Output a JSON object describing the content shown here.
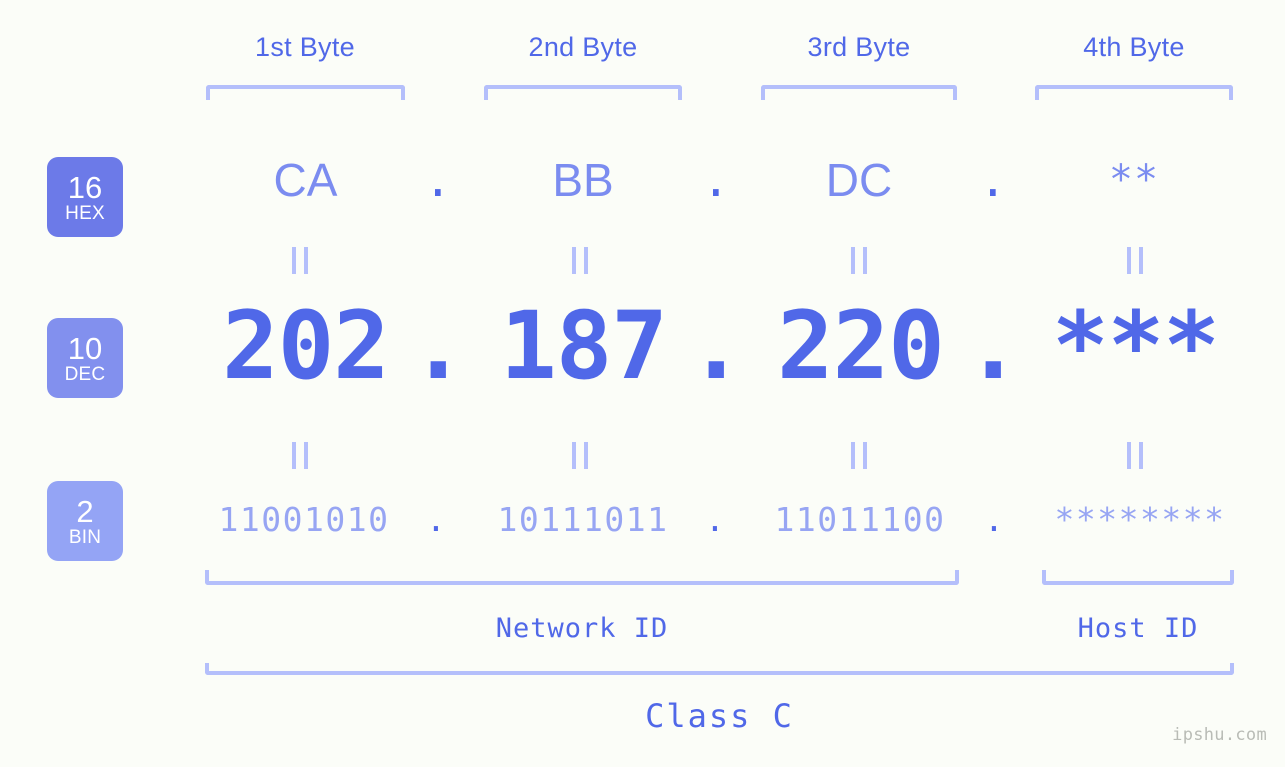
{
  "background_color": "#fbfdf8",
  "accent_color": "#5068e8",
  "bracket_color": "#b4bffb",
  "byte_headers": [
    {
      "label": "1st Byte"
    },
    {
      "label": "2nd Byte"
    },
    {
      "label": "3rd Byte"
    },
    {
      "label": "4th Byte"
    }
  ],
  "bases": [
    {
      "number": "16",
      "name": "HEX",
      "color": "#6c7ae8"
    },
    {
      "number": "10",
      "name": "DEC",
      "color": "#8290ee"
    },
    {
      "number": "2",
      "name": "BIN",
      "color": "#94a4f5"
    }
  ],
  "rows": {
    "hex": {
      "base_number": "16",
      "base_name": "HEX",
      "values": [
        "CA",
        "BB",
        "DC",
        "**"
      ],
      "separator": "."
    },
    "dec": {
      "base_number": "10",
      "base_name": "DEC",
      "values": [
        "202",
        "187",
        "220",
        "***"
      ],
      "separator": "."
    },
    "bin": {
      "base_number": "2",
      "base_name": "BIN",
      "values": [
        "11001010",
        "10111011",
        "11011100",
        "********"
      ],
      "separator": "."
    }
  },
  "equality_symbol": "=",
  "sections": {
    "network_id": "Network ID",
    "host_id": "Host ID"
  },
  "class_label": "Class C",
  "watermark": "ipshu.com"
}
